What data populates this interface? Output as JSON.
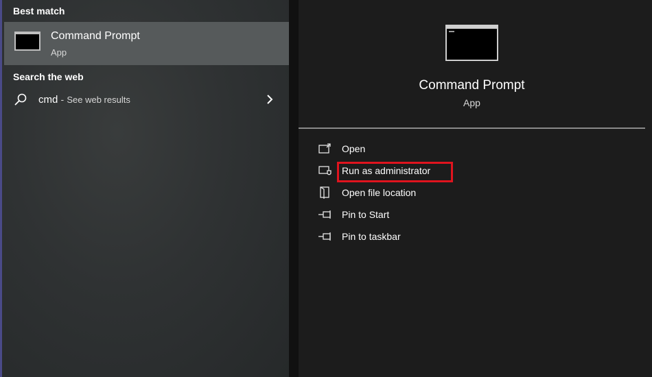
{
  "left": {
    "best_match_header": "Best match",
    "best_match": {
      "title": "Command Prompt",
      "subtitle": "App",
      "icon": "command-prompt-icon"
    },
    "search_web_header": "Search the web",
    "web_result": {
      "query": "cmd",
      "separator": "-",
      "suffix": "See web results",
      "icon": "search-icon",
      "chevron": "chevron-right-icon"
    }
  },
  "details": {
    "title": "Command Prompt",
    "subtitle": "App",
    "icon": "command-prompt-icon",
    "actions": [
      {
        "label": "Open",
        "icon": "open-icon"
      },
      {
        "label": "Run as administrator",
        "icon": "run-as-admin-icon",
        "highlighted": true
      },
      {
        "label": "Open file location",
        "icon": "file-location-icon"
      },
      {
        "label": "Pin to Start",
        "icon": "pin-icon"
      },
      {
        "label": "Pin to taskbar",
        "icon": "pin-icon"
      }
    ]
  },
  "colors": {
    "highlight": "#e0141e",
    "selected_bg": "#565a5b",
    "panel_bg": "#1c1c1c"
  }
}
